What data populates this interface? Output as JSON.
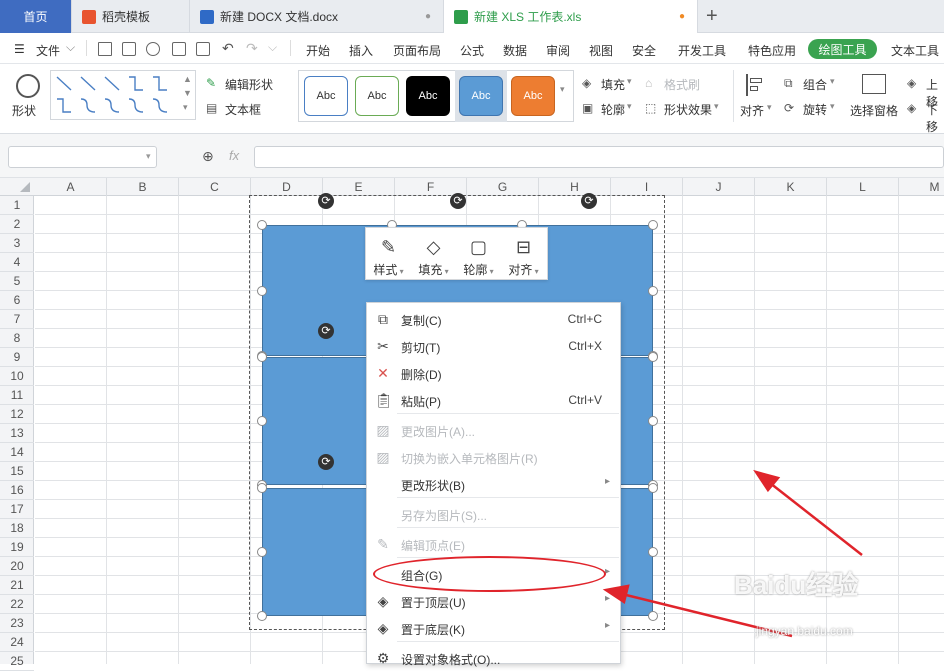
{
  "tabs": [
    {
      "label": "首页"
    },
    {
      "label": "稻壳模板",
      "icon": "daoke-icon"
    },
    {
      "label": "新建 DOCX 文档.docx",
      "icon": "word-doc-icon"
    },
    {
      "label": "新建 XLS 工作表.xls",
      "icon": "excel-sheet-icon"
    }
  ],
  "menubar": {
    "file": "文件",
    "items": [
      "开始",
      "插入",
      "页面布局",
      "公式",
      "数据",
      "审阅",
      "视图",
      "安全",
      "开发工具",
      "特色应用",
      "绘图工具",
      "文本工具"
    ]
  },
  "ribbon": {
    "shape_label": "形状",
    "edit_shape": "编辑形状",
    "textbox": "文本框",
    "style_text": "Abc",
    "fill": "填充",
    "format_brush": "格式刷",
    "outline": "轮廓",
    "shape_effect": "形状效果",
    "align": "对齐",
    "group": "组合",
    "rotate": "旋转",
    "select_pane": "选择窗格",
    "up": "上移",
    "down": "下移"
  },
  "formula": {
    "fx": "fx"
  },
  "columns": [
    "A",
    "B",
    "C",
    "D",
    "E",
    "F",
    "G",
    "H",
    "I",
    "J",
    "K",
    "L",
    "M"
  ],
  "rows": [
    "1",
    "2",
    "3",
    "4",
    "5",
    "6",
    "7",
    "8",
    "9",
    "10",
    "11",
    "12",
    "13",
    "14",
    "15",
    "16",
    "17",
    "18",
    "19",
    "20",
    "21",
    "22",
    "23",
    "24",
    "25"
  ],
  "mini_toolbar": [
    "样式",
    "填充",
    "轮廓",
    "对齐"
  ],
  "context_menu": [
    {
      "label": "复制(C)",
      "shortcut": "Ctrl+C",
      "icon": "copy-icon",
      "enabled": true
    },
    {
      "label": "剪切(T)",
      "shortcut": "Ctrl+X",
      "icon": "cut-icon",
      "enabled": true
    },
    {
      "label": "删除(D)",
      "shortcut": "",
      "icon": "delete-icon",
      "enabled": true
    },
    {
      "label": "粘贴(P)",
      "shortcut": "Ctrl+V",
      "icon": "paste-icon",
      "enabled": true
    },
    {
      "label": "更改图片(A)...",
      "shortcut": "",
      "icon": "change-picture-icon",
      "enabled": false
    },
    {
      "label": "切换为嵌入单元格图片(R)",
      "shortcut": "",
      "icon": "embed-picture-icon",
      "enabled": false
    },
    {
      "label": "更改形状(B)",
      "shortcut": "",
      "icon": "",
      "enabled": true,
      "submenu": true
    },
    {
      "label": "另存为图片(S)...",
      "shortcut": "",
      "icon": "",
      "enabled": false
    },
    {
      "label": "编辑顶点(E)",
      "shortcut": "",
      "icon": "edit-points-icon",
      "enabled": false
    },
    {
      "label": "组合(G)",
      "shortcut": "",
      "icon": "",
      "enabled": true,
      "submenu": true
    },
    {
      "label": "置于顶层(U)",
      "shortcut": "",
      "icon": "bring-to-front-icon",
      "enabled": true,
      "submenu": true
    },
    {
      "label": "置于底层(K)",
      "shortcut": "",
      "icon": "send-to-back-icon",
      "enabled": true,
      "submenu": true
    },
    {
      "label": "设置对象格式(O)...",
      "shortcut": "",
      "icon": "format-object-icon",
      "enabled": true
    }
  ],
  "colors": {
    "shape_fill": "#5b9bd5",
    "accent_green": "#3aa350",
    "home_tab": "#3f6cc1",
    "annotation": "#e0242b"
  },
  "watermark": {
    "brand": "Baidu经验",
    "url": "jingyan.baidu.com"
  }
}
